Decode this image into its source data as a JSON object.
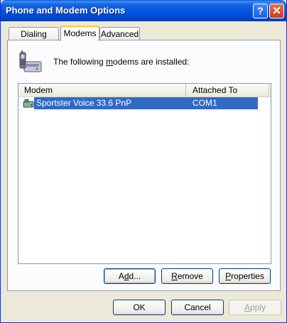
{
  "window": {
    "title": "Phone and Modem Options",
    "help_glyph": "?",
    "close_glyph": "✕"
  },
  "tabs": [
    {
      "label": "Dialing Rules"
    },
    {
      "label": "Modems"
    },
    {
      "label": "Advanced"
    }
  ],
  "modems_tab": {
    "intro_prefix": "The following ",
    "intro_underline": "m",
    "intro_suffix": "odems are  installed:",
    "columns": [
      "Modem",
      "Attached To"
    ],
    "rows": [
      {
        "modem": "Sportster Voice 33.6 PnP",
        "attached_to": "COM1",
        "selected": true
      }
    ],
    "add_button": {
      "pre": "A",
      "ul": "d",
      "post": "d..."
    },
    "remove_button": {
      "pre": "",
      "ul": "R",
      "post": "emove"
    },
    "properties_button": {
      "pre": "",
      "ul": "P",
      "post": "roperties"
    }
  },
  "footer": {
    "ok_label": "OK",
    "cancel_label": "Cancel",
    "apply_button": {
      "pre": "",
      "ul": "A",
      "post": "pply"
    }
  },
  "colors": {
    "selection": "#316ac5",
    "title_bar": "#0054e3",
    "tab_highlight": "#ffc83c"
  }
}
